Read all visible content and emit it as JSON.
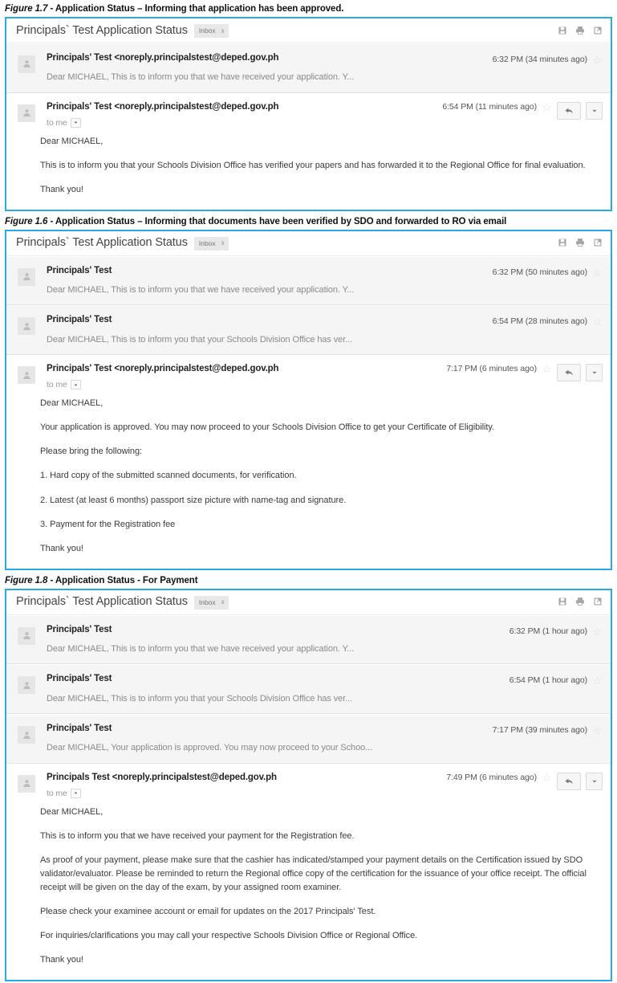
{
  "figures": [
    {
      "caption_label": "Figure 1.7",
      "caption_text": "- Application Status – Informing that application has been approved.",
      "thread": {
        "subject": "Principals` Test Application Status",
        "label_chip": "Inbox",
        "label_chip_x": "x",
        "header_icons": [
          "save-icon",
          "print-icon",
          "popout-icon"
        ],
        "messages": [
          {
            "type": "collapsed",
            "sender": "Principals' Test <noreply.principalstest@deped.gov.ph",
            "snippet": "Dear MICHAEL, This is to inform you that we have received your application. Y...",
            "time": "6:32 PM (34 minutes ago)"
          },
          {
            "type": "expanded",
            "sender": "Principals' Test <noreply.principalstest@deped.gov.ph",
            "to_line": "to me",
            "time": "6:54 PM (11 minutes ago)",
            "paragraphs": [
              "Dear MICHAEL,",
              "This is to inform you that your Schools Division Office has verified your papers and has forwarded it to the Regional Office for final evaluation.",
              "Thank you!"
            ]
          }
        ]
      }
    },
    {
      "caption_label": "Figure 1.6",
      "caption_text": "- Application Status – Informing that documents have been verified by SDO and forwarded to RO via email",
      "thread": {
        "subject": "Principals` Test Application Status",
        "label_chip": "Inbox",
        "label_chip_x": "x",
        "header_icons": [
          "save-icon",
          "print-icon",
          "popout-icon"
        ],
        "messages": [
          {
            "type": "collapsed",
            "sender": "Principals' Test",
            "snippet": "Dear MICHAEL, This is to inform you that we have received your application. Y...",
            "time": "6:32 PM (50 minutes ago)"
          },
          {
            "type": "collapsed",
            "sender": "Principals' Test",
            "snippet": "Dear MICHAEL, This is to inform you that your Schools Division Office has ver...",
            "time": "6:54 PM (28 minutes ago)"
          },
          {
            "type": "expanded",
            "sender": "Principals' Test <noreply.principalstest@deped.gov.ph",
            "to_line": "to me",
            "time": "7:17 PM (6 minutes ago)",
            "paragraphs": [
              "Dear MICHAEL,",
              "Your application is approved. You may now proceed to your Schools Division Office to get your Certificate of Eligibility.",
              "Please bring the following:",
              "1. Hard copy of the submitted scanned documents, for verification.",
              "2. Latest (at least 6 months) passport size picture with name-tag and signature.",
              "3. Payment for the Registration fee",
              "Thank you!"
            ]
          }
        ]
      }
    },
    {
      "caption_label": "Figure 1.8",
      "caption_text": "- Application Status - For Payment",
      "thread": {
        "subject": "Principals` Test Application Status",
        "label_chip": "Inbox",
        "label_chip_x": "x",
        "header_icons": [
          "save-icon",
          "print-icon",
          "popout-icon"
        ],
        "messages": [
          {
            "type": "collapsed",
            "sender": "Principals' Test",
            "snippet": "Dear MICHAEL, This is to inform you that we have received your application. Y...",
            "time": "6:32 PM (1 hour ago)"
          },
          {
            "type": "collapsed",
            "sender": "Principals' Test",
            "snippet": "Dear MICHAEL, This is to inform you that your Schools Division Office has ver...",
            "time": "6:54 PM (1 hour ago)"
          },
          {
            "type": "collapsed",
            "sender": "Principals' Test",
            "snippet": "Dear MICHAEL, Your application is approved. You may now proceed to your Schoo...",
            "time": "7:17 PM (39 minutes ago)"
          },
          {
            "type": "expanded",
            "sender": "Principals Test <noreply.principalstest@deped.gov.ph",
            "to_line": "to me",
            "time": "7:49 PM (6 minutes ago)",
            "paragraphs": [
              "Dear MICHAEL,",
              "This is to inform you that we have received your payment for the Registration fee.",
              "As proof of your payment, please make sure that the cashier has indicated/stamped your payment details on the Certification issued by SDO validator/evaluator. Please be reminded to return the Regional office copy of the certification for the issuance of your office receipt. The official receipt will be given on the day of the exam, by your assigned room examiner.",
              "Please check your examinee account or email for updates on the 2017 Principals' Test.",
              "For inquiries/clarifications you may call your respective Schools Division Office or Regional Office.",
              "Thank you!"
            ]
          }
        ]
      }
    }
  ],
  "colors": {
    "card_border": "#29a9e8",
    "collapsed_row_bg": "#f5f5f5",
    "chip_bg": "#e8e8e8",
    "star": "#dcdcdc"
  }
}
